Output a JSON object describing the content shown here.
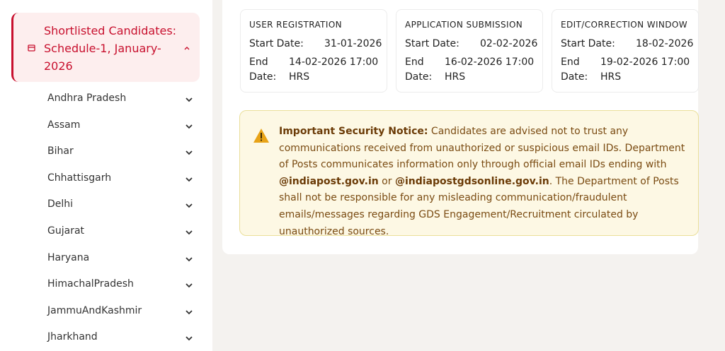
{
  "sidebar": {
    "active_item": {
      "label": "Shortlisted Candidates: Schedule-1, January-2026",
      "icon": "calendar-icon",
      "expanded_icon": "chevron-up-icon"
    },
    "states": [
      "Andhra Pradesh",
      "Assam",
      "Bihar",
      "Chhattisgarh",
      "Delhi",
      "Gujarat",
      "Haryana",
      "HimachalPradesh",
      "JammuAndKashmir",
      "Jharkhand"
    ]
  },
  "schedule": [
    {
      "title": "USER REGISTRATION",
      "start_label": "Start Date:",
      "start_value": "31-01-2026",
      "end_label": "End Date:",
      "end_value": "14-02-2026 17:00 HRS"
    },
    {
      "title": "APPLICATION SUBMISSION",
      "start_label": "Start Date:",
      "start_value": "02-02-2026",
      "end_label": "End Date:",
      "end_value": "16-02-2026 17:00 HRS"
    },
    {
      "title": "EDIT/CORRECTION WINDOW",
      "start_label": "Start Date:",
      "start_value": "18-02-2026",
      "end_label": "End Date:",
      "end_value": "19-02-2026 17:00 HRS"
    }
  ],
  "notice": {
    "icon": "warning-icon",
    "heading": "Important Security Notice:",
    "text_part1": " Candidates are advised not to trust any communications received from unauthorized or suspicious email IDs. Department of Posts communicates information only through official email IDs ending with ",
    "domain1": "@indiapost.gov.in",
    "text_or": " or ",
    "domain2": "@indiapostgdsonline.gov.in",
    "text_part2": ". The Department of Posts shall not be responsible for any misleading communication/fraudulent emails/messages regarding GDS Engagement/Recruitment circulated by unauthorized sources."
  },
  "colors": {
    "accent": "#c8102e",
    "notice_bg": "#fdf8e4",
    "notice_text": "#7a4b12"
  }
}
